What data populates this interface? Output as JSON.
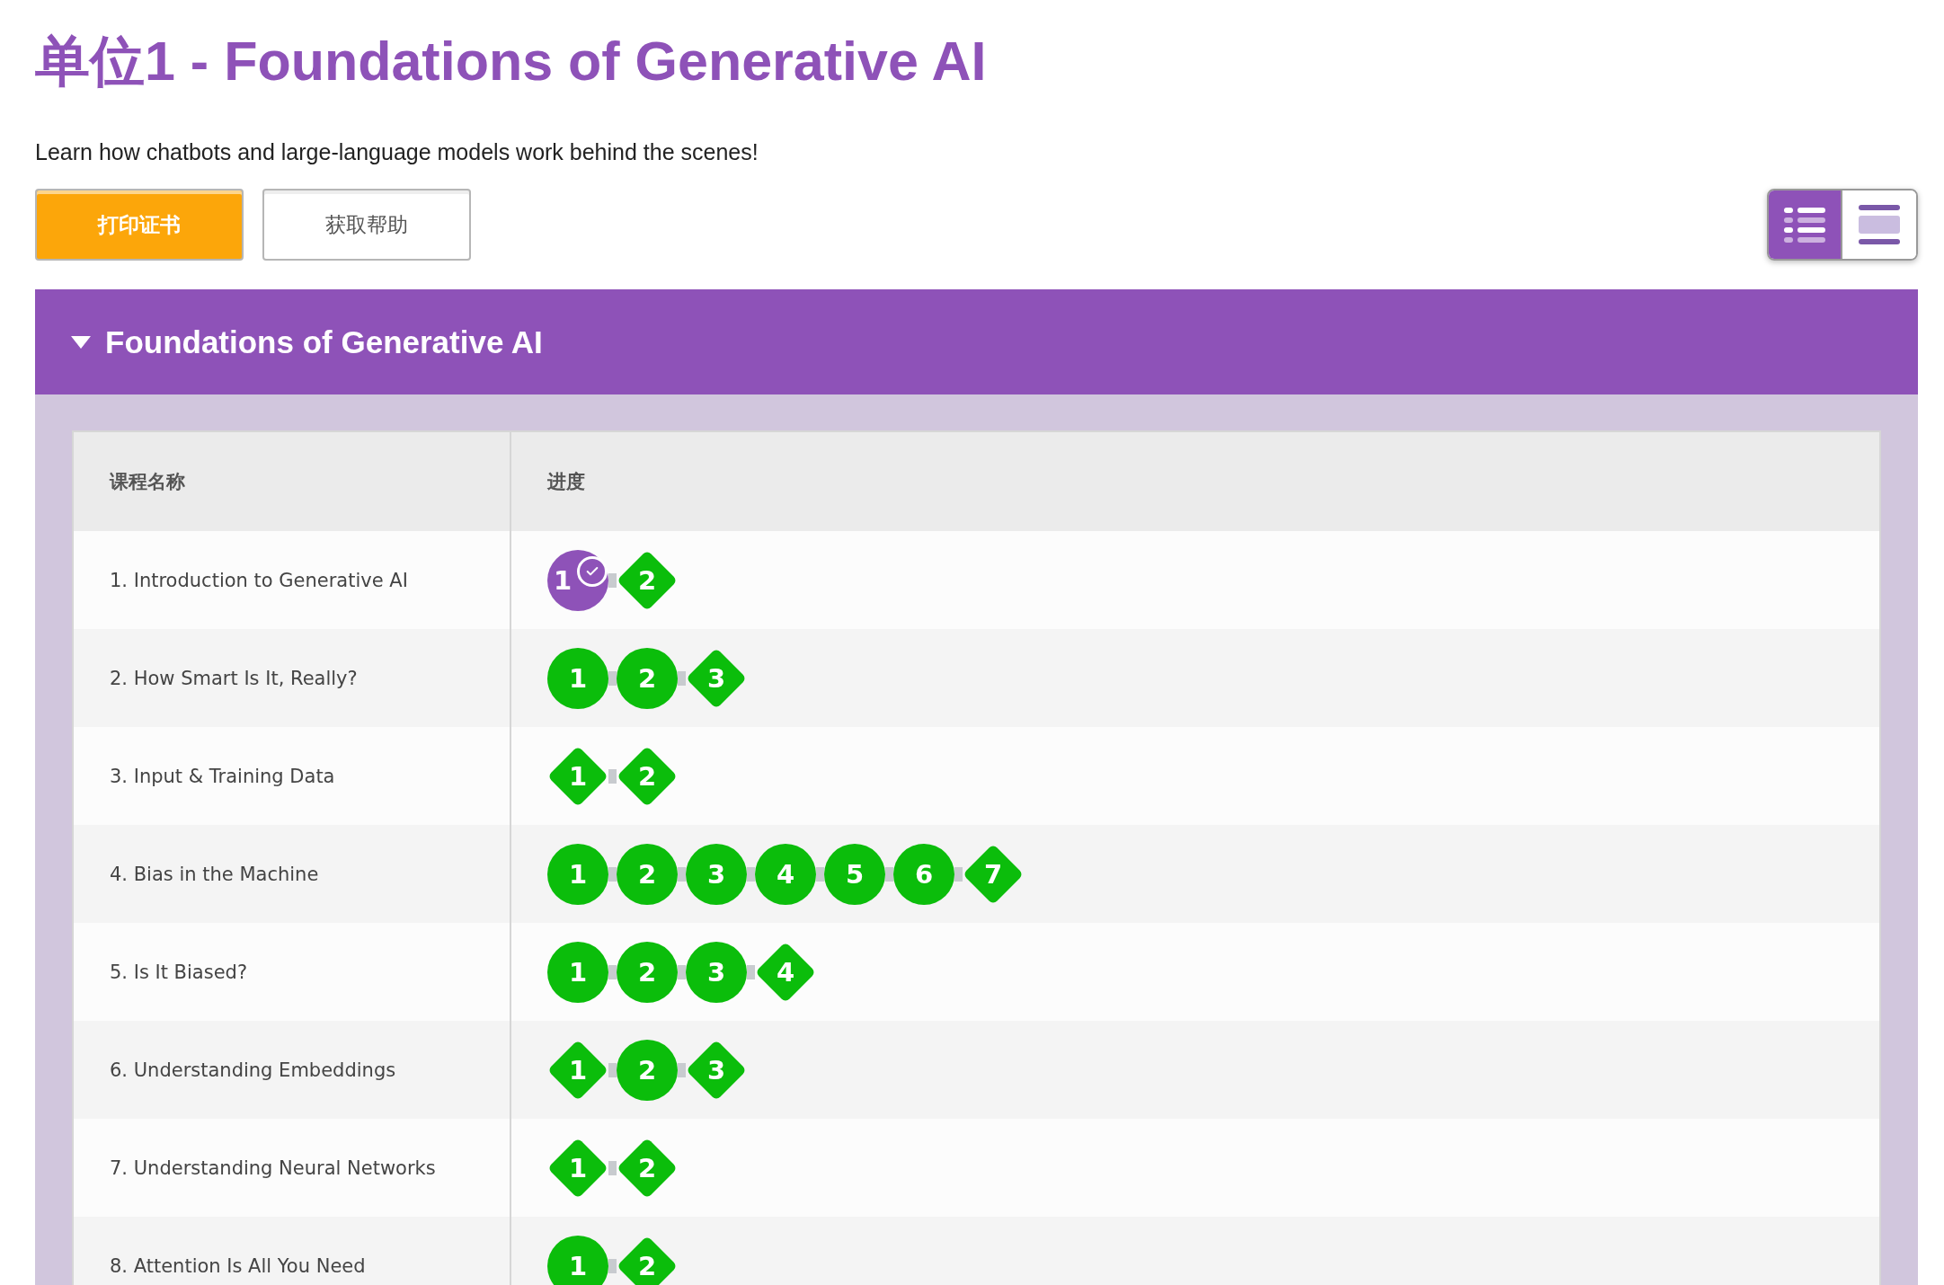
{
  "title": "单位1 - Foundations of Generative AI",
  "subtitle": "Learn how chatbots and large-language models work behind the scenes!",
  "buttons": [
    {
      "label": "打印证书",
      "kind": "primary"
    },
    {
      "label": "获取帮助",
      "kind": "secondary"
    }
  ],
  "view_toggle": [
    {
      "kind": "list",
      "selected": true
    },
    {
      "kind": "summary",
      "selected": false
    }
  ],
  "section": {
    "title": "Foundations of Generative AI",
    "expanded": true,
    "columns": [
      "课程名称",
      "进度"
    ],
    "rows": [
      {
        "name": "1. Introduction to Generative AI",
        "progress": [
          {
            "label": "1",
            "kind": "circle",
            "current": true
          },
          {
            "label": "2",
            "kind": "diamond",
            "current": false
          }
        ]
      },
      {
        "name": "2. How Smart Is It, Really?",
        "progress": [
          {
            "label": "1",
            "kind": "circle",
            "current": false
          },
          {
            "label": "2",
            "kind": "circle",
            "current": false
          },
          {
            "label": "3",
            "kind": "diamond",
            "current": false
          }
        ]
      },
      {
        "name": "3. Input & Training Data",
        "progress": [
          {
            "label": "1",
            "kind": "diamond",
            "current": false
          },
          {
            "label": "2",
            "kind": "diamond",
            "current": false
          }
        ]
      },
      {
        "name": "4. Bias in the Machine",
        "progress": [
          {
            "label": "1",
            "kind": "circle",
            "current": false
          },
          {
            "label": "2",
            "kind": "circle",
            "current": false
          },
          {
            "label": "3",
            "kind": "circle",
            "current": false
          },
          {
            "label": "4",
            "kind": "circle",
            "current": false
          },
          {
            "label": "5",
            "kind": "circle",
            "current": false
          },
          {
            "label": "6",
            "kind": "circle",
            "current": false
          },
          {
            "label": "7",
            "kind": "diamond",
            "current": false
          }
        ]
      },
      {
        "name": "5. Is It Biased?",
        "progress": [
          {
            "label": "1",
            "kind": "circle",
            "current": false
          },
          {
            "label": "2",
            "kind": "circle",
            "current": false
          },
          {
            "label": "3",
            "kind": "circle",
            "current": false
          },
          {
            "label": "4",
            "kind": "diamond",
            "current": false
          }
        ]
      },
      {
        "name": "6. Understanding Embeddings",
        "progress": [
          {
            "label": "1",
            "kind": "diamond",
            "current": false
          },
          {
            "label": "2",
            "kind": "circle",
            "current": false
          },
          {
            "label": "3",
            "kind": "diamond",
            "current": false
          }
        ]
      },
      {
        "name": "7. Understanding Neural Networks",
        "progress": [
          {
            "label": "1",
            "kind": "diamond",
            "current": false
          },
          {
            "label": "2",
            "kind": "diamond",
            "current": false
          }
        ]
      },
      {
        "name": "8. Attention Is All You Need",
        "progress": [
          {
            "label": "1",
            "kind": "circle",
            "current": false
          },
          {
            "label": "2",
            "kind": "diamond",
            "current": false
          }
        ]
      }
    ]
  }
}
